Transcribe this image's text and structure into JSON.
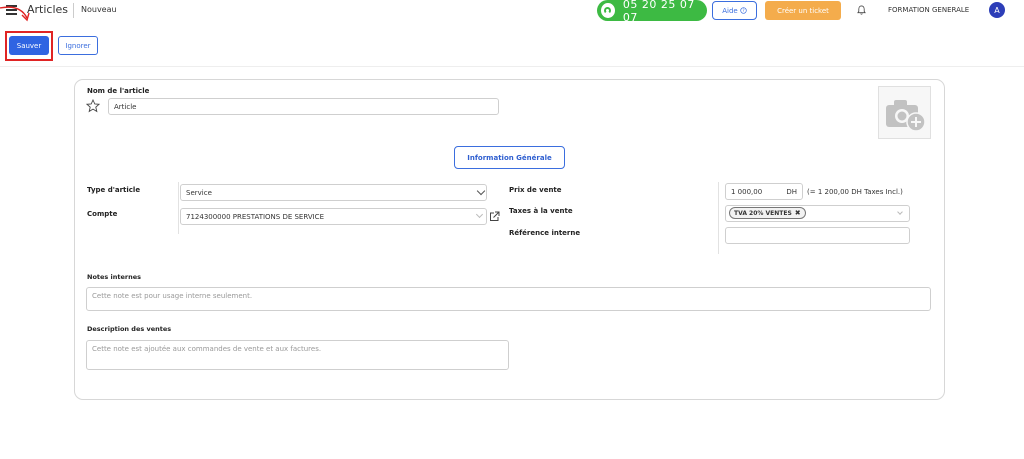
{
  "header": {
    "app_title": "Articles",
    "breadcrumb": "Nouveau",
    "phone": "05 20 25 07 07",
    "aide_label": "Aide",
    "ticket_label": "Créer un ticket",
    "company": "FORMATION GENERALE",
    "avatar_letter": "A"
  },
  "actions": {
    "save_label": "Sauver",
    "ignore_label": "Ignorer"
  },
  "form": {
    "name_label": "Nom de l'article",
    "name_value": "Article",
    "info_tab": "Information Générale",
    "type_label": "Type d'article",
    "type_value": "Service",
    "account_label": "Compte",
    "account_value": "7124300000 PRESTATIONS DE SERVICE",
    "price_label": "Prix de vente",
    "price_value": "1 000,00",
    "price_currency": "DH",
    "price_hint": "(= 1 200,00 DH Taxes Incl.)",
    "taxes_label": "Taxes à la vente",
    "tax_tag": "TVA 20% VENTES",
    "ref_label": "Référence interne",
    "ref_value": "",
    "notes_label": "Notes internes",
    "notes_placeholder": "Cette note est pour usage interne seulement.",
    "desc_label": "Description des ventes",
    "desc_placeholder": "Cette note est ajoutée aux commandes de vente et aux factures."
  },
  "colors": {
    "primary": "#2f64e2",
    "phone_green": "#3dba43",
    "ticket_orange": "#f4ac4c",
    "highlight_red": "#e02424"
  }
}
